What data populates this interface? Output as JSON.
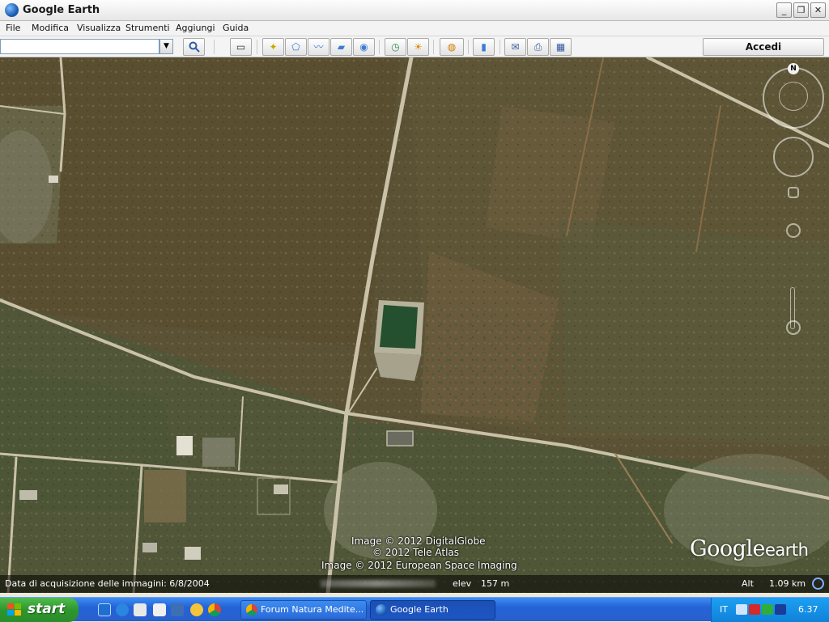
{
  "window": {
    "title": "Google Earth",
    "buttons": {
      "minimize": "_",
      "maximize": "❐",
      "close": "✕"
    }
  },
  "menu": {
    "items": [
      "File",
      "Modifica",
      "Visualizza",
      "Strumenti",
      "Aggiungi",
      "Guida"
    ]
  },
  "toolbar": {
    "search_value": "",
    "search_icon": "magnifier-icon",
    "buttons": [
      {
        "name": "sidebar-toggle-icon",
        "glyph": "▭"
      },
      {
        "name": "add-placemark-icon",
        "glyph": "✦"
      },
      {
        "name": "add-polygon-icon",
        "glyph": "⬠"
      },
      {
        "name": "add-path-icon",
        "glyph": "〰"
      },
      {
        "name": "add-overlay-icon",
        "glyph": "▰"
      },
      {
        "name": "record-tour-icon",
        "glyph": "◉"
      },
      {
        "name": "historical-imagery-icon",
        "glyph": "◷"
      },
      {
        "name": "sunlight-icon",
        "glyph": "☀"
      },
      {
        "name": "planets-icon",
        "glyph": "◍"
      },
      {
        "name": "ruler-icon",
        "glyph": "▮"
      },
      {
        "name": "email-icon",
        "glyph": "✉"
      },
      {
        "name": "print-icon",
        "glyph": "⎙"
      },
      {
        "name": "save-image-icon",
        "glyph": "▦"
      }
    ],
    "sign_in_label": "Accedi"
  },
  "map": {
    "attribution": [
      "Image © 2012 DigitalGlobe",
      "© 2012 Tele Atlas",
      "Image © 2012 European Space Imaging"
    ],
    "logo_word": "Google",
    "logo_suffix": "earth",
    "compass_north": "N",
    "status": {
      "imagery_date": "Data di acquisizione delle immagini: 6/8/2004",
      "elev_label": "elev",
      "elev_value": "157 m",
      "alt_label": "Alt",
      "alt_value": "1.09 km"
    }
  },
  "taskbar": {
    "start_label": "start",
    "tasks": [
      {
        "label": "Forum Natura Medite...",
        "icon": "chrome-icon"
      },
      {
        "label": "Google Earth",
        "icon": "google-earth-icon"
      }
    ],
    "tray_lang": "IT",
    "clock": "6.37"
  }
}
